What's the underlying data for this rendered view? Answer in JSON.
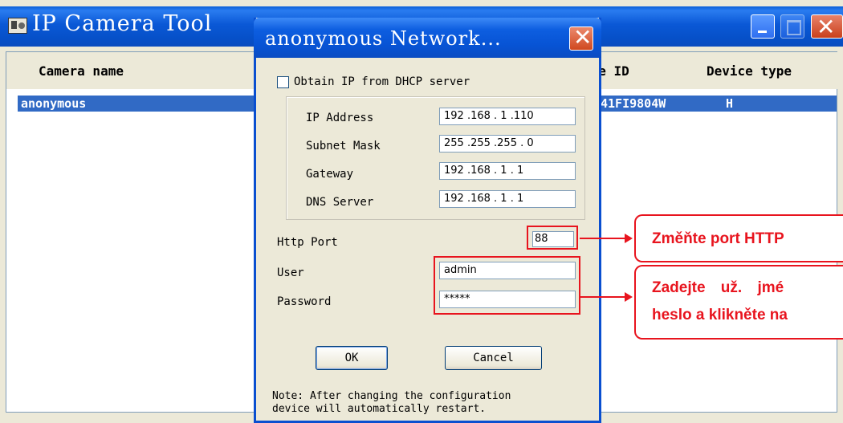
{
  "main_window": {
    "title": "IP Camera Tool",
    "columns": {
      "camera_name": "Camera name",
      "device_id": "ice ID",
      "device_type": "Device type"
    },
    "rows": [
      {
        "camera_name": "anonymous",
        "device_id": "41FI9804W",
        "device_type": "H"
      }
    ]
  },
  "dialog": {
    "title": "anonymous Network...",
    "dhcp_label": "Obtain IP from DHCP server",
    "dhcp_checked": false,
    "fields": [
      {
        "label": "IP Address",
        "value": "192 .168 . 1  .110"
      },
      {
        "label": "Subnet Mask",
        "value": "255 .255 .255 . 0"
      },
      {
        "label": "Gateway",
        "value": "192 .168 . 1  . 1"
      },
      {
        "label": "DNS Server",
        "value": "192 .168 . 1  . 1"
      }
    ],
    "http_port_label": "Http Port",
    "http_port_value": "88",
    "user_label": "User",
    "user_value": "admin",
    "password_label": "Password",
    "password_value": "*****",
    "ok_label": "OK",
    "cancel_label": "Cancel",
    "note_line1": "Note: After changing the configuration",
    "note_line2": "device will automatically restart."
  },
  "annotations": {
    "callout1": "Změňte port HTTP",
    "callout2_line1": "Zadejte už. jmé",
    "callout2_line2": "heslo a klikněte na"
  },
  "colors": {
    "highlight": "#e8141e",
    "titlebar": "#0a58d6",
    "selection": "#316ac5"
  }
}
